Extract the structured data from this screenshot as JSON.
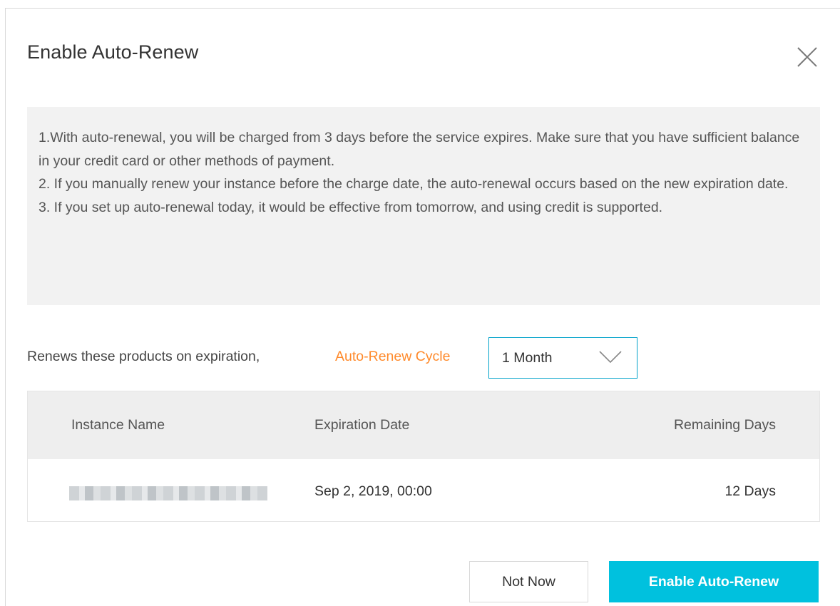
{
  "dialog": {
    "title": "Enable Auto-Renew",
    "close_icon": "close-icon"
  },
  "notice": {
    "lines": [
      "1.With auto-renewal, you will be charged from 3 days before the service expires. Make sure that you have sufficient balance in your credit card or other methods of payment.",
      "2. If you manually renew your instance before the charge date, the auto-renewal occurs based on the new expiration date.",
      "3. If you set up auto-renewal today, it would be effective from tomorrow, and using credit is supported."
    ]
  },
  "cycle": {
    "text": "Renews these products on expiration,",
    "link": "Auto-Renew Cycle",
    "selected": "1 Month",
    "icon": "chevron-down-icon"
  },
  "table": {
    "headers": [
      "Instance Name",
      "Expiration Date",
      "Remaining Days"
    ],
    "rows": [
      {
        "expiration": "Sep 2, 2019, 00:00",
        "remaining": "12 Days"
      }
    ]
  },
  "buttons": {
    "secondary": "Not Now",
    "primary": "Enable Auto-Renew"
  },
  "colors": {
    "accent": "#00c1de",
    "link": "#ff8a2b",
    "select_border": "#00a2ca",
    "notice_bg": "#f2f2f2",
    "table_header_bg": "#eeeeee"
  }
}
